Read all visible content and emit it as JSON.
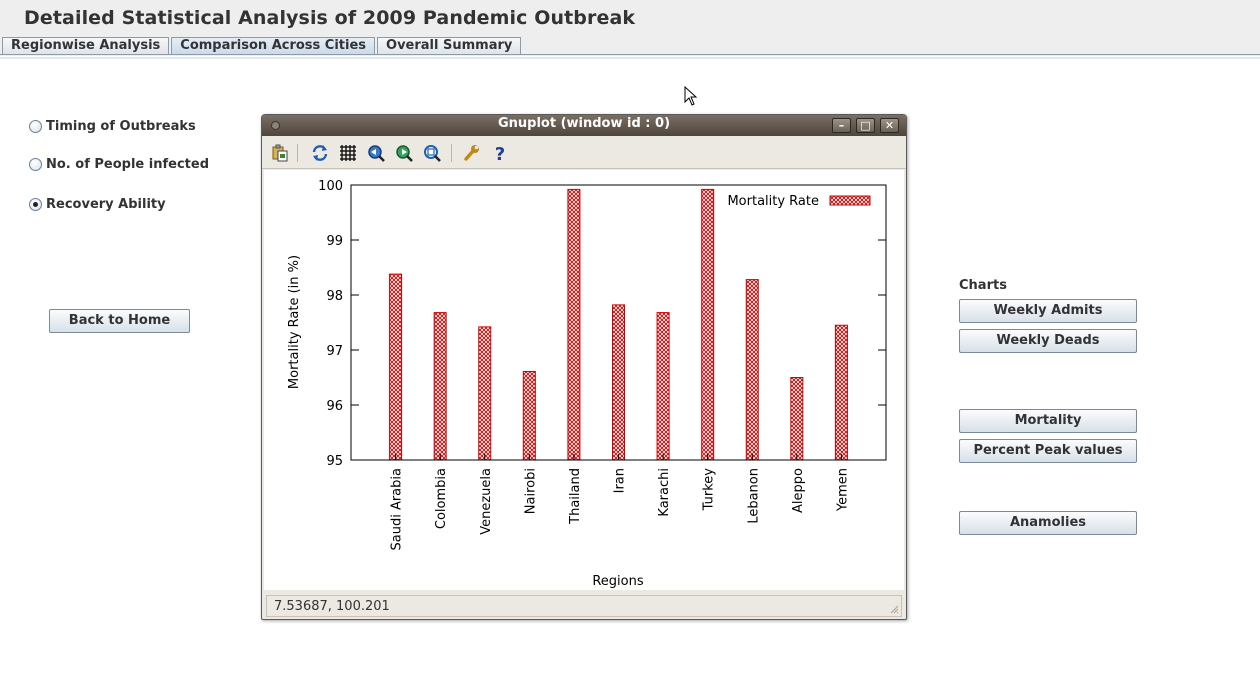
{
  "app": {
    "title": "Detailed Statistical Analysis of 2009 Pandemic Outbreak"
  },
  "tabs": [
    {
      "label": "Regionwise Analysis",
      "selected": false
    },
    {
      "label": "Comparison Across Cities",
      "selected": true
    },
    {
      "label": "Overall Summary",
      "selected": false
    }
  ],
  "options": [
    {
      "label": "Timing of Outbreaks",
      "checked": false
    },
    {
      "label": "No. of People infected",
      "checked": false
    },
    {
      "label": "Recovery Ability",
      "checked": true
    }
  ],
  "back_button": {
    "label": "Back to Home"
  },
  "charts_panel": {
    "label": "Charts",
    "buttons": [
      "Weekly Admits",
      "Weekly Deads",
      "Mortality",
      "Percent Peak values",
      "Anamolies"
    ]
  },
  "gnuplot": {
    "title": "Gnuplot (window id : 0)",
    "status": "7.53687,  100.201",
    "toolbar_icons": [
      "copy-to-clipboard-icon",
      "replot-icon",
      "grid-icon",
      "zoom-previous-icon",
      "zoom-next-icon",
      "autoscale-icon",
      "settings-icon",
      "help-icon"
    ]
  },
  "colors": {
    "bar": "#cc0000",
    "accent_tab": "#c8d9ea"
  },
  "chart_data": {
    "type": "bar",
    "title": "",
    "xlabel": "Regions",
    "ylabel": "Mortality Rate (in %)",
    "categories": [
      "Saudi Arabia",
      "Colombia",
      "Venezuela",
      "Nairobi",
      "Thailand",
      "Iran",
      "Karachi",
      "Turkey",
      "Lebanon",
      "Aleppo",
      "Yemen"
    ],
    "series": [
      {
        "name": "Mortality Rate",
        "values": [
          98.38,
          97.68,
          97.42,
          96.61,
          99.92,
          97.82,
          97.68,
          99.92,
          98.28,
          96.5,
          97.45
        ]
      }
    ],
    "ylim": [
      95,
      100
    ],
    "yticks": [
      "95",
      "96",
      "97",
      "98",
      "99",
      "100"
    ],
    "legend": "top-right",
    "grid": false,
    "bar_pattern": "crosshatch"
  }
}
